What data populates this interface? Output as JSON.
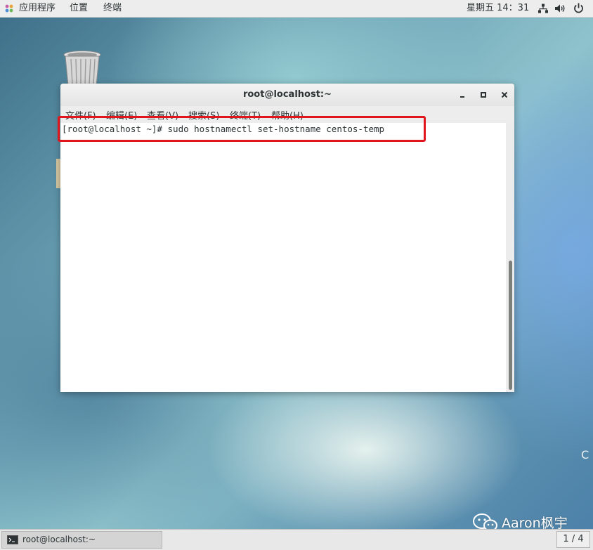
{
  "topbar": {
    "applications": "应用程序",
    "places": "位置",
    "terminal": "终端",
    "clock": "星期五 14：31"
  },
  "window": {
    "title": "root@localhost:~",
    "menu": [
      "文件(F)",
      "编辑(E)",
      "查看(V)",
      "搜索(S)",
      "终端(T)",
      "帮助(H)"
    ],
    "prompt_line": "[root@localhost ~]# sudo hostnamectl set-hostname centos-temp"
  },
  "taskbar": {
    "task_label": "root@localhost:~",
    "pager": "1 / 4"
  },
  "desktop": {
    "edge_letter": "C"
  },
  "watermark": {
    "text": "Aaron枫宇"
  },
  "colors": {
    "highlight_border": "#e0161c",
    "topbar_bg": "#ededed",
    "terminal_bg": "#ffffff"
  }
}
